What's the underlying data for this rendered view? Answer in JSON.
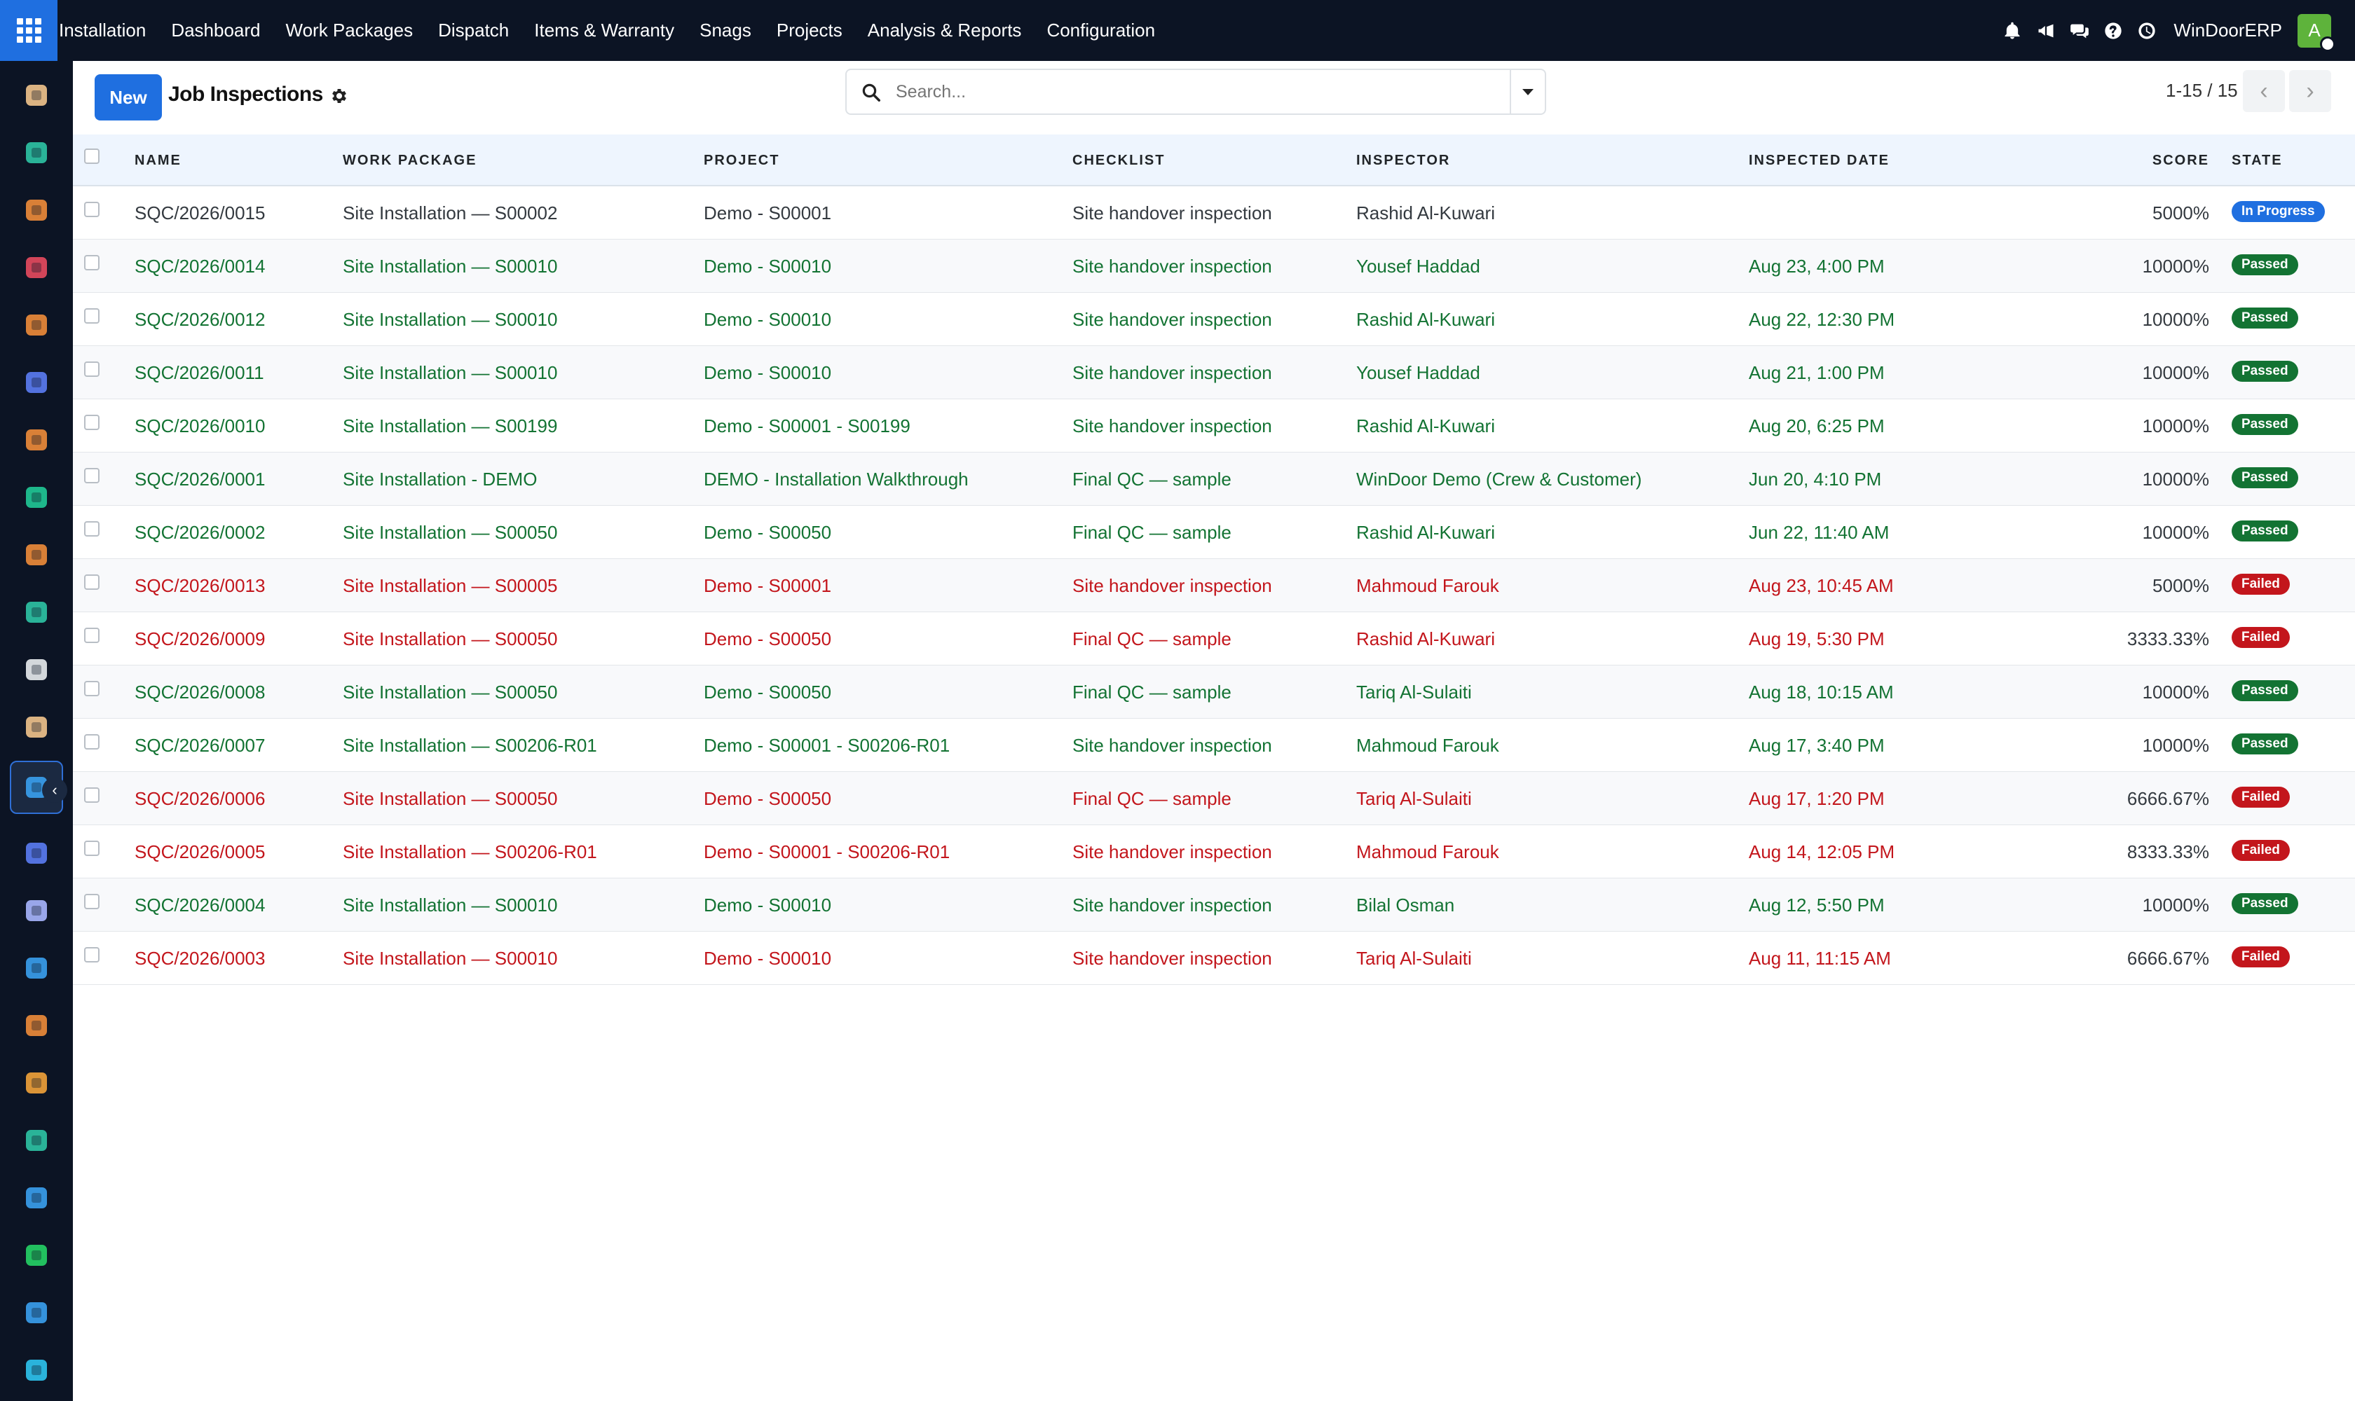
{
  "navbar": {
    "app_name": "Installation",
    "menu": [
      "Dashboard",
      "Work Packages",
      "Dispatch",
      "Items & Warranty",
      "Snags",
      "Projects",
      "Analysis & Reports",
      "Configuration"
    ],
    "company": "WinDoorERP",
    "avatar_initial": "A",
    "icons": [
      "bell-icon",
      "megaphone-icon",
      "chat-icon",
      "help-icon",
      "clock-icon"
    ]
  },
  "sidebar": {
    "apps": [
      {
        "icon": "app-icon-1",
        "color": "#f2c48d"
      },
      {
        "icon": "app-icon-2",
        "color": "#2ec4a5"
      },
      {
        "icon": "app-icon-3",
        "color": "#f08c3a"
      },
      {
        "icon": "app-icon-4",
        "color": "#e84a5f"
      },
      {
        "icon": "app-icon-5",
        "color": "#f08c3a"
      },
      {
        "icon": "app-icon-6",
        "color": "#5b7cf4"
      },
      {
        "icon": "app-icon-7",
        "color": "#f08c3a"
      },
      {
        "icon": "app-icon-8",
        "color": "#20c997"
      },
      {
        "icon": "app-icon-9",
        "color": "#f08c3a"
      },
      {
        "icon": "app-icon-10",
        "color": "#2ec4a5"
      },
      {
        "icon": "app-icon-11",
        "color": "#e9ecef"
      },
      {
        "icon": "app-icon-12",
        "color": "#f2c48d"
      },
      {
        "icon": "app-icon-13",
        "color": "#3aa0f0"
      },
      {
        "icon": "app-icon-14",
        "color": "#5b7cf4"
      },
      {
        "icon": "app-icon-15",
        "color": "#a9b6ff"
      },
      {
        "icon": "app-icon-16",
        "color": "#3aa0f0"
      },
      {
        "icon": "app-icon-17",
        "color": "#f08c3a"
      },
      {
        "icon": "app-icon-18",
        "color": "#f2a23a"
      },
      {
        "icon": "app-icon-19",
        "color": "#2ec4a5"
      },
      {
        "icon": "app-icon-20",
        "color": "#3aa0f0"
      },
      {
        "icon": "app-icon-21",
        "color": "#25d366"
      },
      {
        "icon": "app-icon-22",
        "color": "#3aa0f0"
      },
      {
        "icon": "app-icon-23",
        "color": "#2ec4f0"
      }
    ]
  },
  "control_panel": {
    "new_label": "New",
    "title": "Job Inspections",
    "search_placeholder": "Search...",
    "pager_value": "1-15 / 15"
  },
  "table": {
    "columns": {
      "name": "NAME",
      "work_package": "WORK PACKAGE",
      "project": "PROJECT",
      "checklist": "CHECKLIST",
      "inspector": "INSPECTOR",
      "inspected_date": "INSPECTED DATE",
      "score": "SCORE",
      "state": "STATE"
    },
    "state_colors": {
      "In Progress": "#1f6fe0",
      "Passed": "#137333",
      "Failed": "#c3161c"
    },
    "rows": [
      {
        "name": "SQC/2026/0015",
        "work_package": "Site Installation — S00002",
        "project": "Demo - S00001",
        "checklist": "Site handover inspection",
        "inspector": "Rashid Al-Kuwari",
        "inspected_date": "",
        "score": "5000%",
        "state": "In Progress"
      },
      {
        "name": "SQC/2026/0014",
        "work_package": "Site Installation — S00010",
        "project": "Demo - S00010",
        "checklist": "Site handover inspection",
        "inspector": "Yousef Haddad",
        "inspected_date": "Aug 23, 4:00 PM",
        "score": "10000%",
        "state": "Passed"
      },
      {
        "name": "SQC/2026/0012",
        "work_package": "Site Installation — S00010",
        "project": "Demo - S00010",
        "checklist": "Site handover inspection",
        "inspector": "Rashid Al-Kuwari",
        "inspected_date": "Aug 22, 12:30 PM",
        "score": "10000%",
        "state": "Passed"
      },
      {
        "name": "SQC/2026/0011",
        "work_package": "Site Installation — S00010",
        "project": "Demo - S00010",
        "checklist": "Site handover inspection",
        "inspector": "Yousef Haddad",
        "inspected_date": "Aug 21, 1:00 PM",
        "score": "10000%",
        "state": "Passed"
      },
      {
        "name": "SQC/2026/0010",
        "work_package": "Site Installation — S00199",
        "project": "Demo - S00001 - S00199",
        "checklist": "Site handover inspection",
        "inspector": "Rashid Al-Kuwari",
        "inspected_date": "Aug 20, 6:25 PM",
        "score": "10000%",
        "state": "Passed"
      },
      {
        "name": "SQC/2026/0001",
        "work_package": "Site Installation - DEMO",
        "project": "DEMO - Installation Walkthrough",
        "checklist": "Final QC — sample",
        "inspector": "WinDoor Demo (Crew & Customer)",
        "inspected_date": "Jun 20, 4:10 PM",
        "score": "10000%",
        "state": "Passed"
      },
      {
        "name": "SQC/2026/0002",
        "work_package": "Site Installation — S00050",
        "project": "Demo - S00050",
        "checklist": "Final QC — sample",
        "inspector": "Rashid Al-Kuwari",
        "inspected_date": "Jun 22, 11:40 AM",
        "score": "10000%",
        "state": "Passed"
      },
      {
        "name": "SQC/2026/0013",
        "work_package": "Site Installation — S00005",
        "project": "Demo - S00001",
        "checklist": "Site handover inspection",
        "inspector": "Mahmoud Farouk",
        "inspected_date": "Aug 23, 10:45 AM",
        "score": "5000%",
        "state": "Failed"
      },
      {
        "name": "SQC/2026/0009",
        "work_package": "Site Installation — S00050",
        "project": "Demo - S00050",
        "checklist": "Final QC — sample",
        "inspector": "Rashid Al-Kuwari",
        "inspected_date": "Aug 19, 5:30 PM",
        "score": "3333.33%",
        "state": "Failed"
      },
      {
        "name": "SQC/2026/0008",
        "work_package": "Site Installation — S00050",
        "project": "Demo - S00050",
        "checklist": "Final QC — sample",
        "inspector": "Tariq Al-Sulaiti",
        "inspected_date": "Aug 18, 10:15 AM",
        "score": "10000%",
        "state": "Passed"
      },
      {
        "name": "SQC/2026/0007",
        "work_package": "Site Installation — S00206-R01",
        "project": "Demo - S00001 - S00206-R01",
        "checklist": "Site handover inspection",
        "inspector": "Mahmoud Farouk",
        "inspected_date": "Aug 17, 3:40 PM",
        "score": "10000%",
        "state": "Passed"
      },
      {
        "name": "SQC/2026/0006",
        "work_package": "Site Installation — S00050",
        "project": "Demo - S00050",
        "checklist": "Final QC — sample",
        "inspector": "Tariq Al-Sulaiti",
        "inspected_date": "Aug 17, 1:20 PM",
        "score": "6666.67%",
        "state": "Failed"
      },
      {
        "name": "SQC/2026/0005",
        "work_package": "Site Installation — S00206-R01",
        "project": "Demo - S00001 - S00206-R01",
        "checklist": "Site handover inspection",
        "inspector": "Mahmoud Farouk",
        "inspected_date": "Aug 14, 12:05 PM",
        "score": "8333.33%",
        "state": "Failed"
      },
      {
        "name": "SQC/2026/0004",
        "work_package": "Site Installation — S00010",
        "project": "Demo - S00010",
        "checklist": "Site handover inspection",
        "inspector": "Bilal Osman",
        "inspected_date": "Aug 12, 5:50 PM",
        "score": "10000%",
        "state": "Passed"
      },
      {
        "name": "SQC/2026/0003",
        "work_package": "Site Installation — S00010",
        "project": "Demo - S00010",
        "checklist": "Site handover inspection",
        "inspector": "Tariq Al-Sulaiti",
        "inspected_date": "Aug 11, 11:15 AM",
        "score": "6666.67%",
        "state": "Failed"
      }
    ]
  }
}
